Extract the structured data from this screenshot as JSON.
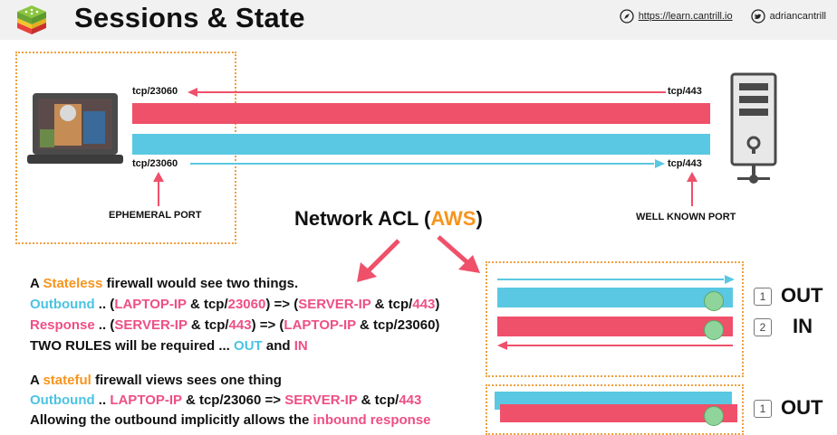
{
  "header": {
    "title": "Sessions & State",
    "link": "https://learn.cantrill.io",
    "handle": "adriancantrill"
  },
  "diagram": {
    "left_port_top": "tcp/23060",
    "left_port_bottom": "tcp/23060",
    "right_port_top": "tcp/443",
    "right_port_bottom": "tcp/443",
    "ephemeral_label": "EPHEMERAL PORT",
    "wellknown_label": "WELL KNOWN PORT",
    "center_title_prefix": "Network ACL (",
    "center_title_aws": "AWS",
    "center_title_suffix": ")"
  },
  "stateless": {
    "line1_a": "A ",
    "line1_b": "Stateless",
    "line1_c": " firewall would see two things.",
    "line2": [
      {
        "t": "Outbound",
        "c": "blue"
      },
      {
        "t": " .. (",
        "c": ""
      },
      {
        "t": "LAPTOP-IP",
        "c": "pink"
      },
      {
        "t": " & tcp/",
        "c": ""
      },
      {
        "t": "23060",
        "c": "pink"
      },
      {
        "t": ") => (",
        "c": ""
      },
      {
        "t": "SERVER-IP",
        "c": "pink"
      },
      {
        "t": " & tcp/",
        "c": ""
      },
      {
        "t": "443",
        "c": "pink"
      },
      {
        "t": ")",
        "c": ""
      }
    ],
    "line3": [
      {
        "t": "Response",
        "c": "pink"
      },
      {
        "t": " .. (",
        "c": ""
      },
      {
        "t": "SERVER-IP",
        "c": "pink"
      },
      {
        "t": " & tcp/",
        "c": ""
      },
      {
        "t": "443",
        "c": "pink"
      },
      {
        "t": ") => (",
        "c": ""
      },
      {
        "t": "LAPTOP-IP",
        "c": "pink"
      },
      {
        "t": " & tcp/23060)",
        "c": ""
      }
    ],
    "line4": [
      {
        "t": "TWO RULES will be required ... ",
        "c": ""
      },
      {
        "t": "OUT",
        "c": "blue"
      },
      {
        "t": " and ",
        "c": ""
      },
      {
        "t": "IN",
        "c": "pink"
      }
    ],
    "rule1_num": "1",
    "rule1_dir": "OUT",
    "rule2_num": "2",
    "rule2_dir": "IN"
  },
  "stateful": {
    "line1": [
      {
        "t": "A ",
        "c": ""
      },
      {
        "t": "stateful",
        "c": "orange"
      },
      {
        "t": " firewall views sees one thing",
        "c": ""
      }
    ],
    "line2": [
      {
        "t": "Outbound",
        "c": "blue"
      },
      {
        "t": " .. ",
        "c": ""
      },
      {
        "t": "LAPTOP-IP",
        "c": "pink"
      },
      {
        "t": " & tcp/23060 => ",
        "c": ""
      },
      {
        "t": "SERVER-IP",
        "c": "pink"
      },
      {
        "t": " & tcp/",
        "c": ""
      },
      {
        "t": "443",
        "c": "pink"
      }
    ],
    "line3": [
      {
        "t": "Allowing the outbound implicitly allows the ",
        "c": ""
      },
      {
        "t": "inbound response",
        "c": "pink"
      }
    ],
    "rule1_num": "1",
    "rule1_dir": "OUT"
  },
  "colors": {
    "red": "#ef506a",
    "blue": "#5ac8e2",
    "orange": "#f7941d",
    "pink": "#ee4f86"
  }
}
